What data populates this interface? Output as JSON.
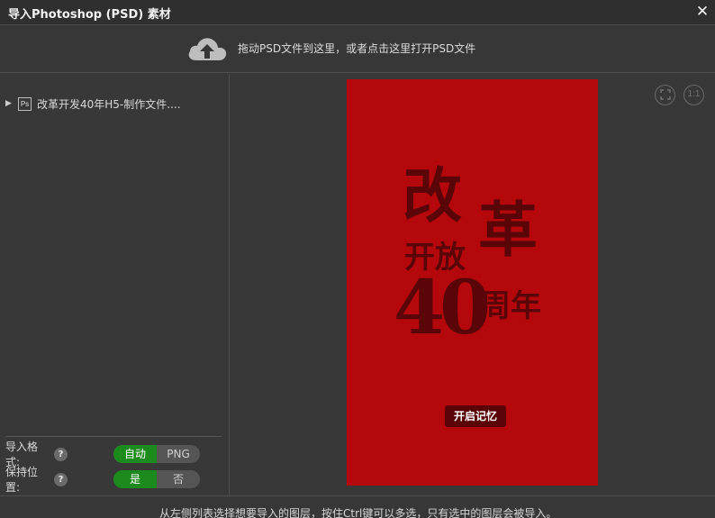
{
  "dialog": {
    "title": "导入Photoshop (PSD) 素材",
    "close_icon": "close-icon"
  },
  "dropzone": {
    "icon": "cloud-upload-icon",
    "hint": "拖动PSD文件到这里，或者点击这里打开PSD文件"
  },
  "tree": {
    "items": [
      {
        "label": "改革开发40年H5-制作文件....",
        "icon": "psd-file-icon",
        "icon_text": "Ps",
        "expanded": false
      }
    ]
  },
  "options": {
    "format": {
      "label": "导入格式:",
      "choices": [
        "自动",
        "PNG"
      ],
      "selected": "自动"
    },
    "keep_position": {
      "label": "保持位置:",
      "choices": [
        "是",
        "否"
      ],
      "selected": "是"
    },
    "help_glyph": "?"
  },
  "preview": {
    "fit_icon": "fit-screen-icon",
    "actual_size_label": "1:1",
    "canvas_background": "#b5080c",
    "poster": {
      "char_gai": "改",
      "char_ge": "革",
      "text_kaifang": "开放",
      "text_40": "40",
      "text_zhounian": "周年",
      "button": "开启记忆"
    }
  },
  "footer": {
    "message": "从左侧列表选择想要导入的图层，按住Ctrl键可以多选，只有选中的图层会被导入。"
  },
  "colors": {
    "accent_green": "#1d8a1d",
    "panel_bg": "#383838",
    "poster_red": "#b5080c",
    "poster_dark": "#5a0608"
  }
}
